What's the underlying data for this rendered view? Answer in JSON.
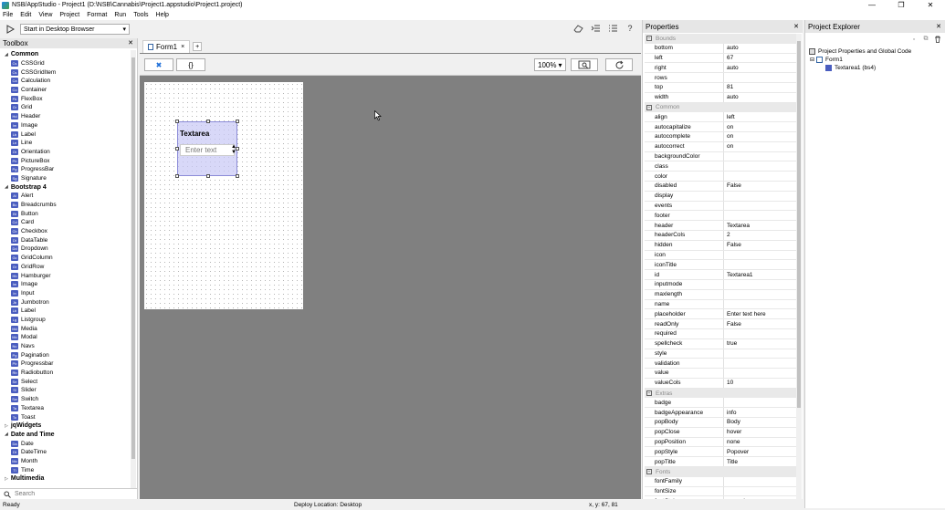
{
  "window": {
    "title": "NSB/AppStudio - Project1 (D:\\NSB\\Cannabis\\Project1.appstudio\\Project1.project)",
    "controls": [
      "—",
      "❐",
      "✕"
    ]
  },
  "menu": [
    "File",
    "Edit",
    "View",
    "Project",
    "Format",
    "Run",
    "Tools",
    "Help"
  ],
  "toolbar": {
    "run_target": "Start in Desktop Browser",
    "help_label": "?"
  },
  "toolbox": {
    "title": "Toolbox",
    "groups": [
      {
        "label": "Common",
        "expanded": true,
        "items": [
          {
            "label": "CSSGrid",
            "abbr": "Cs"
          },
          {
            "label": "CSSGridItem",
            "abbr": "Cs"
          },
          {
            "label": "Calculation",
            "abbr": "Ca"
          },
          {
            "label": "Container",
            "abbr": "Co"
          },
          {
            "label": "FlexBox",
            "abbr": "Fb"
          },
          {
            "label": "Grid",
            "abbr": "Gr"
          },
          {
            "label": "Header",
            "abbr": "Hd"
          },
          {
            "label": "Image",
            "abbr": "Im"
          },
          {
            "label": "Label",
            "abbr": "Lb"
          },
          {
            "label": "Line",
            "abbr": "Ln"
          },
          {
            "label": "Orientation",
            "abbr": "Or"
          },
          {
            "label": "PictureBox",
            "abbr": "Pb"
          },
          {
            "label": "ProgressBar",
            "abbr": "Pg"
          },
          {
            "label": "Signature",
            "abbr": "Sg"
          }
        ]
      },
      {
        "label": "Bootstrap 4",
        "expanded": true,
        "items": [
          {
            "label": "Alert",
            "abbr": "Al"
          },
          {
            "label": "Breadcrumbs",
            "abbr": "Bc"
          },
          {
            "label": "Button",
            "abbr": "Bt"
          },
          {
            "label": "Card",
            "abbr": "Cd"
          },
          {
            "label": "Checkbox",
            "abbr": "Cb"
          },
          {
            "label": "DataTable",
            "abbr": "Dt"
          },
          {
            "label": "Dropdown",
            "abbr": "Dd"
          },
          {
            "label": "GridColumn",
            "abbr": "Gc"
          },
          {
            "label": "GridRow",
            "abbr": "Gr"
          },
          {
            "label": "Hamburger",
            "abbr": "Hb"
          },
          {
            "label": "Image",
            "abbr": "Im"
          },
          {
            "label": "Input",
            "abbr": "In"
          },
          {
            "label": "Jumbotron",
            "abbr": "Jb"
          },
          {
            "label": "Label",
            "abbr": "Lb"
          },
          {
            "label": "Listgroup",
            "abbr": "Lg"
          },
          {
            "label": "Media",
            "abbr": "Md"
          },
          {
            "label": "Modal",
            "abbr": "Mo"
          },
          {
            "label": "Navs",
            "abbr": "Nv"
          },
          {
            "label": "Pagination",
            "abbr": "Pg"
          },
          {
            "label": "Progressbar",
            "abbr": "Pb"
          },
          {
            "label": "Radiobutton",
            "abbr": "Rb"
          },
          {
            "label": "Select",
            "abbr": "Se"
          },
          {
            "label": "Slider",
            "abbr": "Sl"
          },
          {
            "label": "Switch",
            "abbr": "Sw"
          },
          {
            "label": "Textarea",
            "abbr": "Ta"
          },
          {
            "label": "Toast",
            "abbr": "To"
          }
        ]
      },
      {
        "label": "jqWidgets",
        "expanded": false,
        "items": []
      },
      {
        "label": "Date and Time",
        "expanded": true,
        "items": [
          {
            "label": "Date",
            "abbr": "Da"
          },
          {
            "label": "DateTime",
            "abbr": "Dt"
          },
          {
            "label": "Month",
            "abbr": "Mo"
          },
          {
            "label": "Time",
            "abbr": "Ti"
          }
        ]
      },
      {
        "label": "Multimedia",
        "expanded": false,
        "items": []
      }
    ],
    "search_placeholder": "Search"
  },
  "document": {
    "tab_label": "Form1",
    "tab_close": "×",
    "add_tab": "+",
    "design_mode_icon": "✖",
    "code_mode_label": "{}",
    "zoom": "100%",
    "widget": {
      "header": "Textarea",
      "placeholder": "Enter text"
    }
  },
  "properties": {
    "title": "Properties",
    "sections": [
      {
        "category": "Bounds",
        "rows": [
          {
            "name": "bottom",
            "value": "auto"
          },
          {
            "name": "left",
            "value": "67"
          },
          {
            "name": "right",
            "value": "auto"
          },
          {
            "name": "rows",
            "value": ""
          },
          {
            "name": "top",
            "value": "81"
          },
          {
            "name": "width",
            "value": "auto"
          }
        ]
      },
      {
        "category": "Common",
        "rows": [
          {
            "name": "align",
            "value": "left"
          },
          {
            "name": "autocapitalize",
            "value": "on"
          },
          {
            "name": "autocomplete",
            "value": "on"
          },
          {
            "name": "autocorrect",
            "value": "on"
          },
          {
            "name": "backgroundColor",
            "value": ""
          },
          {
            "name": "class",
            "value": ""
          },
          {
            "name": "color",
            "value": ""
          },
          {
            "name": "disabled",
            "value": "False"
          },
          {
            "name": "display",
            "value": ""
          },
          {
            "name": "events",
            "value": ""
          },
          {
            "name": "footer",
            "value": ""
          },
          {
            "name": "header",
            "value": "Textarea"
          },
          {
            "name": "headerCols",
            "value": "2"
          },
          {
            "name": "hidden",
            "value": "False"
          },
          {
            "name": "icon",
            "value": ""
          },
          {
            "name": "iconTitle",
            "value": ""
          },
          {
            "name": "id",
            "value": "Textarea1"
          },
          {
            "name": "inputmode",
            "value": ""
          },
          {
            "name": "maxlength",
            "value": ""
          },
          {
            "name": "name",
            "value": ""
          },
          {
            "name": "placeholder",
            "value": "Enter text here"
          },
          {
            "name": "readOnly",
            "value": "False"
          },
          {
            "name": "required",
            "value": ""
          },
          {
            "name": "spellcheck",
            "value": "true"
          },
          {
            "name": "style",
            "value": ""
          },
          {
            "name": "validation",
            "value": ""
          },
          {
            "name": "value",
            "value": ""
          },
          {
            "name": "valueCols",
            "value": "10"
          }
        ]
      },
      {
        "category": "Extras",
        "rows": [
          {
            "name": "badge",
            "value": ""
          },
          {
            "name": "badgeAppearance",
            "value": "info"
          },
          {
            "name": "popBody",
            "value": "Body"
          },
          {
            "name": "popClose",
            "value": "hover"
          },
          {
            "name": "popPosition",
            "value": "none"
          },
          {
            "name": "popStyle",
            "value": "Popover"
          },
          {
            "name": "popTitle",
            "value": "Title"
          }
        ]
      },
      {
        "category": "Fonts",
        "rows": [
          {
            "name": "fontFamily",
            "value": ""
          },
          {
            "name": "fontSize",
            "value": ""
          },
          {
            "name": "fontStyle",
            "value": "normal"
          }
        ]
      }
    ]
  },
  "explorer": {
    "title": "Project Explorer",
    "root": "Project Properties and Global Code",
    "form": "Form1",
    "control": "Textarea1 (bs4)"
  },
  "status": {
    "left": "Ready",
    "middle": "Deploy Location: Desktop",
    "right": "x, y: 67, 81"
  },
  "colors": {
    "selection_fill": "#c8c8f5",
    "icon_blue": "#4a5dbf",
    "canvas_bg": "#808080"
  }
}
